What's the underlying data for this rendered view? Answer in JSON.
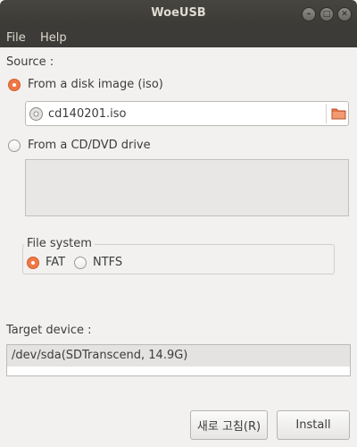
{
  "window": {
    "title": "WoeUSB"
  },
  "menu": {
    "file": "File",
    "help": "Help"
  },
  "source": {
    "label": "Source :",
    "disk_image_option": "From a disk image (iso)",
    "iso_filename": "cd140201.iso",
    "cd_option": "From a CD/DVD drive",
    "selected": "disk_image"
  },
  "filesystem": {
    "label": "File system",
    "fat": "FAT",
    "ntfs": "NTFS",
    "selected": "FAT"
  },
  "target": {
    "label": "Target device :",
    "devices": [
      "/dev/sda(SDTranscend, 14.9G)"
    ]
  },
  "buttons": {
    "refresh": "새로 고침(R)",
    "install": "Install"
  },
  "colors": {
    "accent": "#f07746",
    "titlebar": "#3c3b37"
  },
  "icons": [
    "disc-icon",
    "folder-icon",
    "minimize-icon",
    "maximize-icon",
    "close-icon"
  ]
}
